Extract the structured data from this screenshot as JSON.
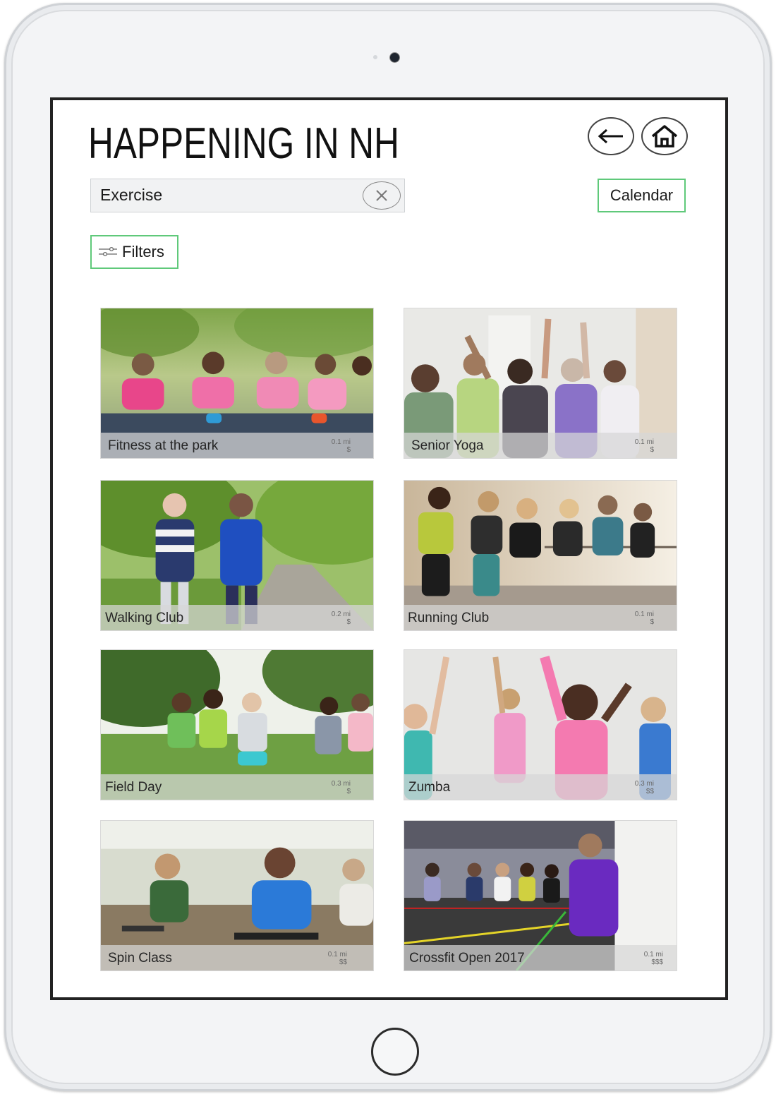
{
  "app": {
    "title": "HAPPENING IN NH"
  },
  "nav": {
    "back_icon": "arrow-left-icon",
    "home_icon": "house-icon"
  },
  "search": {
    "value": "Exercise",
    "placeholder": "",
    "clear_icon": "x-icon"
  },
  "buttons": {
    "calendar": "Calendar",
    "filters": "Filters",
    "filters_icon": "sliders-icon"
  },
  "colors": {
    "button_border": "#5fc97a",
    "title": "#111111"
  },
  "events": [
    {
      "name": "Fitness at the park",
      "distance": "0.1 mi",
      "price": "$"
    },
    {
      "name": "Senior Yoga",
      "distance": "0.1 mi",
      "price": "$"
    },
    {
      "name": "Walking Club",
      "distance": "0.2 mi",
      "price": "$"
    },
    {
      "name": "Running Club",
      "distance": "0.1 mi",
      "price": "$"
    },
    {
      "name": "Field Day",
      "distance": "0.3 mi",
      "price": "$"
    },
    {
      "name": "Zumba",
      "distance": "0.3 mi",
      "price": "$$"
    },
    {
      "name": "Spin Class",
      "distance": "0.1 mi",
      "price": "$$"
    },
    {
      "name": "Crossfit Open 2017",
      "distance": "0.1 mi",
      "price": "$$$"
    }
  ]
}
